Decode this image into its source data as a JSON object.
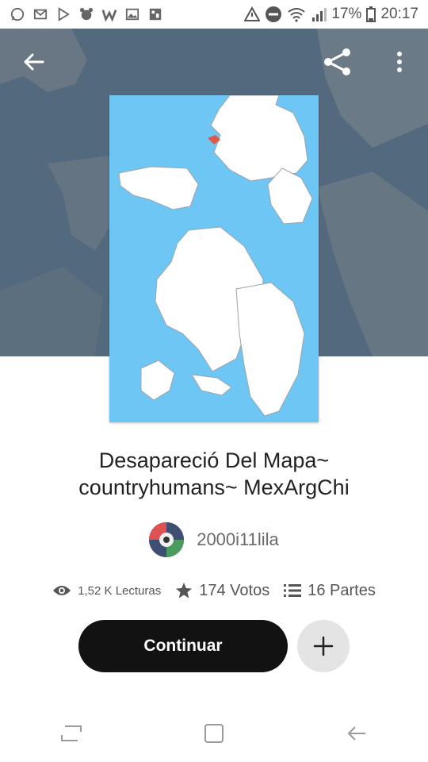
{
  "status_bar": {
    "battery": "17%",
    "time": "20:17",
    "left_icons": [
      "whatsapp-icon",
      "gmail-icon",
      "play-store-icon",
      "notification-app-icon",
      "wattpad-icon",
      "gallery-icon",
      "photo-icon"
    ],
    "right_icons": [
      "warning-icon",
      "do-not-disturb-icon",
      "wifi-icon",
      "signal-icon",
      "battery-icon"
    ]
  },
  "story": {
    "title_line1": "Desapareció Del Mapa~",
    "title_line2": "countryhumans~ MexArgChi",
    "author": "2000i11lila"
  },
  "stats": {
    "reads": "1,52 K Lecturas",
    "votes": "174 Votos",
    "parts": "16 Partes"
  },
  "actions": {
    "continue_label": "Continuar"
  },
  "colors": {
    "hero_background": "#536a7e",
    "cover_ocean": "#6ec6f5",
    "button_dark": "#121212",
    "button_light": "#e4e4e4"
  }
}
